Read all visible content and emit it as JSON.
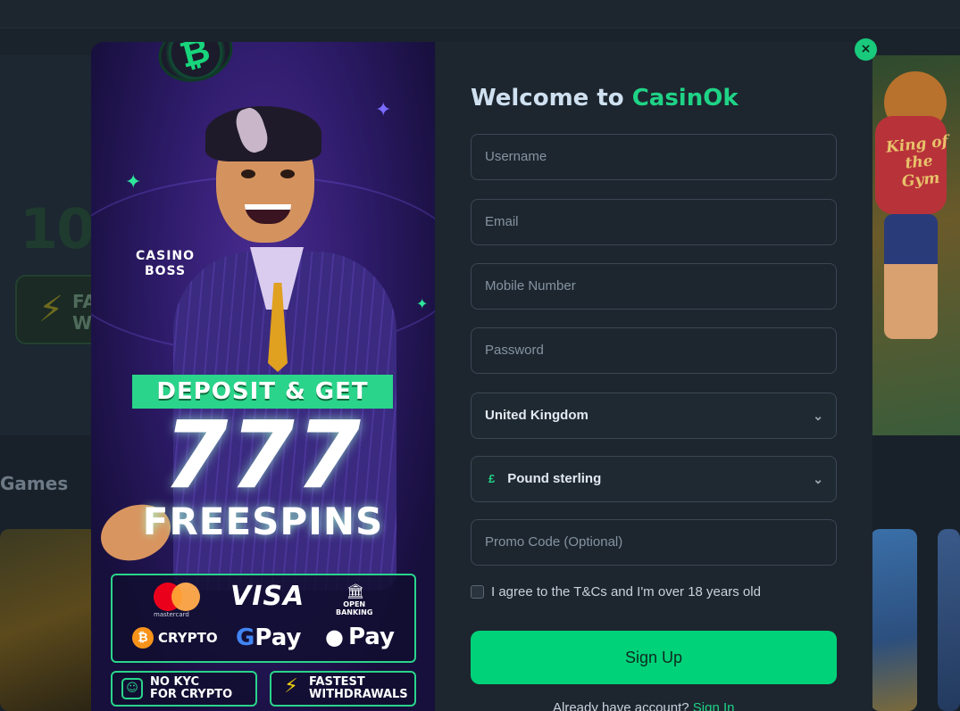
{
  "background": {
    "hero_text": "10",
    "pill_text_1": "FA",
    "pill_text_2": "W",
    "games_heading": "Games",
    "game_banner": "King of the Gym"
  },
  "modal": {
    "close_label": "×",
    "promo": {
      "casino_boss_line1": "CASINO",
      "casino_boss_line2": "BOSS",
      "deposit_banner": "DEPOSIT & GET",
      "spins_count": "777",
      "spins_label": "FREESPINS",
      "payments": {
        "mastercard_label": "mastercard",
        "visa": "VISA",
        "open_banking_line1": "OPEN",
        "open_banking_line2": "BANKING",
        "crypto": "CRYPTO",
        "gpay_g": "G",
        "gpay_pay": "Pay",
        "apple_pay": "Pay"
      },
      "badges": [
        {
          "line1": "NO KYC",
          "line2": "FOR CRYPTO"
        },
        {
          "line1": "FASTEST",
          "line2": "WITHDRAWALS"
        }
      ]
    },
    "form": {
      "title_prefix": "Welcome to ",
      "title_brand": "CasinOk",
      "username_placeholder": "Username",
      "email_placeholder": "Email",
      "mobile_placeholder": "Mobile Number",
      "password_placeholder": "Password",
      "country_value": "United Kingdom",
      "currency_symbol": "£",
      "currency_value": "Pound sterling",
      "promo_placeholder": "Promo Code (Optional)",
      "agree_label": "I agree to the T&Cs and I'm over 18 years old",
      "signup_label": "Sign Up",
      "already_text": "Already have account?",
      "signin_link": "Sign In"
    }
  },
  "colors": {
    "accent": "#1fd386",
    "button": "#00d27a",
    "panel": "#1d262f"
  }
}
